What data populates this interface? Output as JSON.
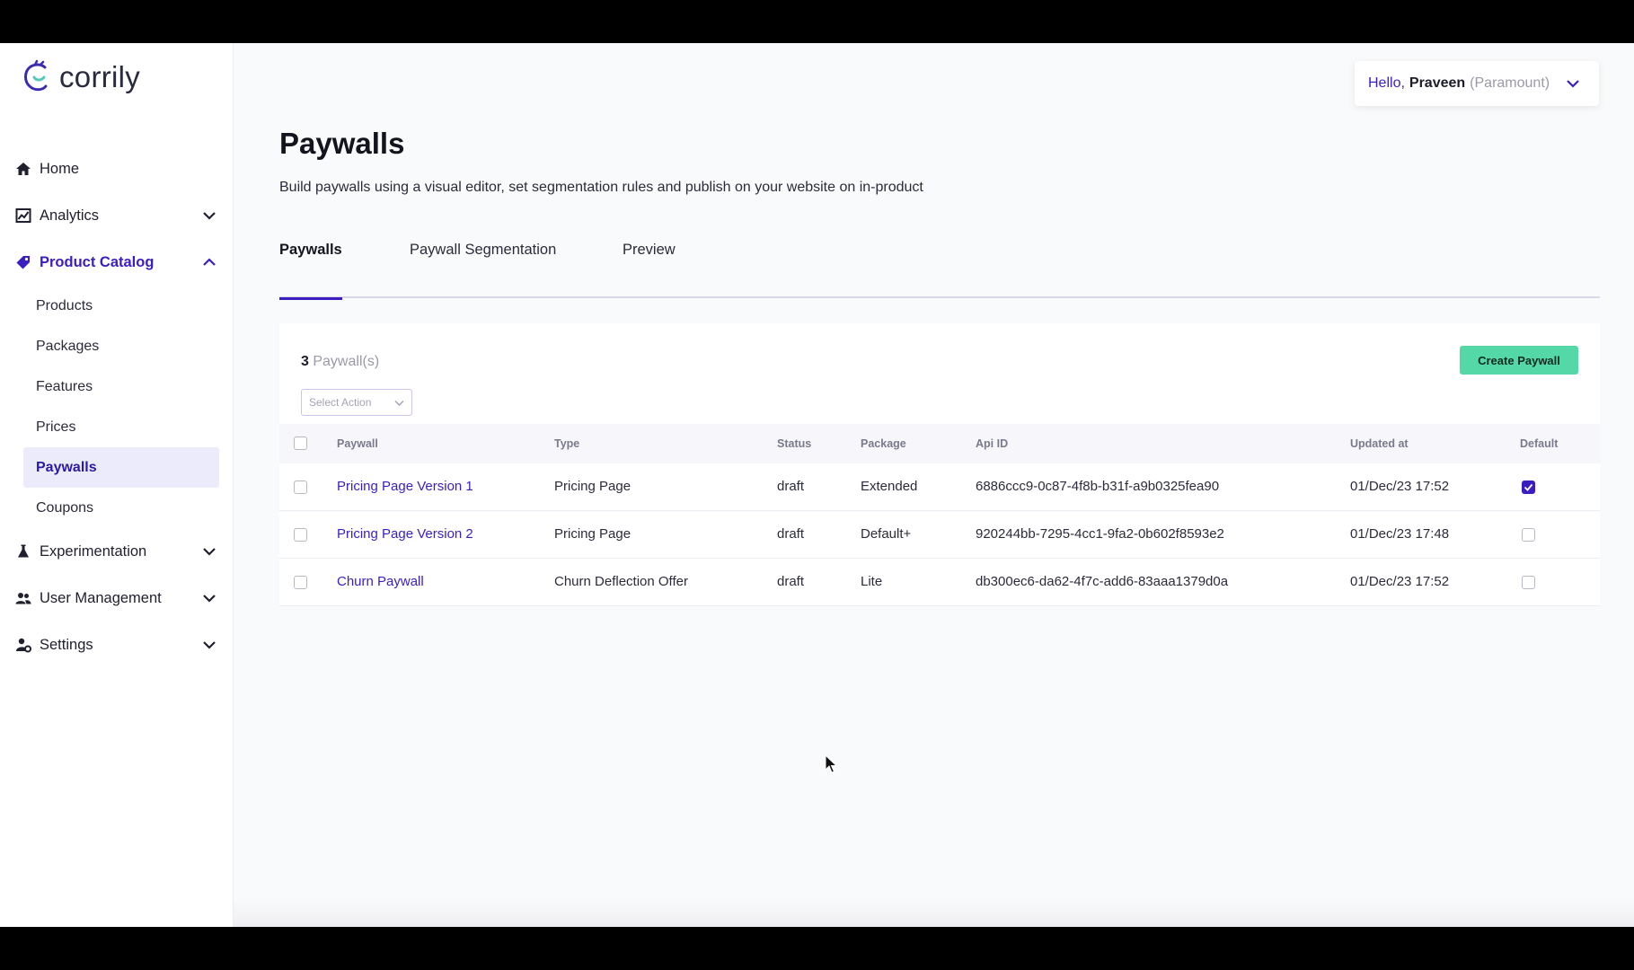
{
  "brand": {
    "name": "corrily",
    "accent": "#3b1ec2",
    "logo_color": "#3a2bb0",
    "cta_color": "#54d8a8"
  },
  "header": {
    "hello": "Hello,",
    "name": "Praveen",
    "org": "(Paramount)"
  },
  "sidebar": {
    "items": [
      {
        "label": "Home",
        "icon": "home-icon"
      },
      {
        "label": "Analytics",
        "icon": "analytics-icon"
      },
      {
        "label": "Product Catalog",
        "icon": "tag-icon"
      },
      {
        "label": "Experimentation",
        "icon": "flask-icon"
      },
      {
        "label": "User Management",
        "icon": "users-icon"
      },
      {
        "label": "Settings",
        "icon": "settings-icon"
      }
    ],
    "product_catalog_sub": [
      "Products",
      "Packages",
      "Features",
      "Prices",
      "Paywalls",
      "Coupons"
    ]
  },
  "page": {
    "title": "Paywalls",
    "subtitle": "Build paywalls using a visual editor, set segmentation rules and publish on your website on in-product"
  },
  "tabs": [
    "Paywalls",
    "Paywall Segmentation",
    "Preview"
  ],
  "list": {
    "count": "3",
    "count_unit": "Paywall(s)",
    "create_label": "Create Paywall",
    "select_action_placeholder": "Select Action"
  },
  "table": {
    "headers": [
      "Paywall",
      "Type",
      "Status",
      "Package",
      "Api ID",
      "Updated at",
      "Default"
    ],
    "rows": [
      {
        "paywall": "Pricing Page Version 1",
        "type": "Pricing Page",
        "status": "draft",
        "package": "Extended",
        "api_id": "6886ccc9-0c87-4f8b-b31f-a9b0325fea90",
        "updated": "01/Dec/23 17:52",
        "default": true
      },
      {
        "paywall": "Pricing Page Version 2",
        "type": "Pricing Page",
        "status": "draft",
        "package": "Default+",
        "api_id": "920244bb-7295-4cc1-9fa2-0b602f8593e2",
        "updated": "01/Dec/23 17:48",
        "default": false
      },
      {
        "paywall": "Churn Paywall",
        "type": "Churn Deflection Offer",
        "status": "draft",
        "package": "Lite",
        "api_id": "db300ec6-da62-4f7c-add6-83aaa1379d0a",
        "updated": "01/Dec/23 17:52",
        "default": false
      }
    ]
  }
}
